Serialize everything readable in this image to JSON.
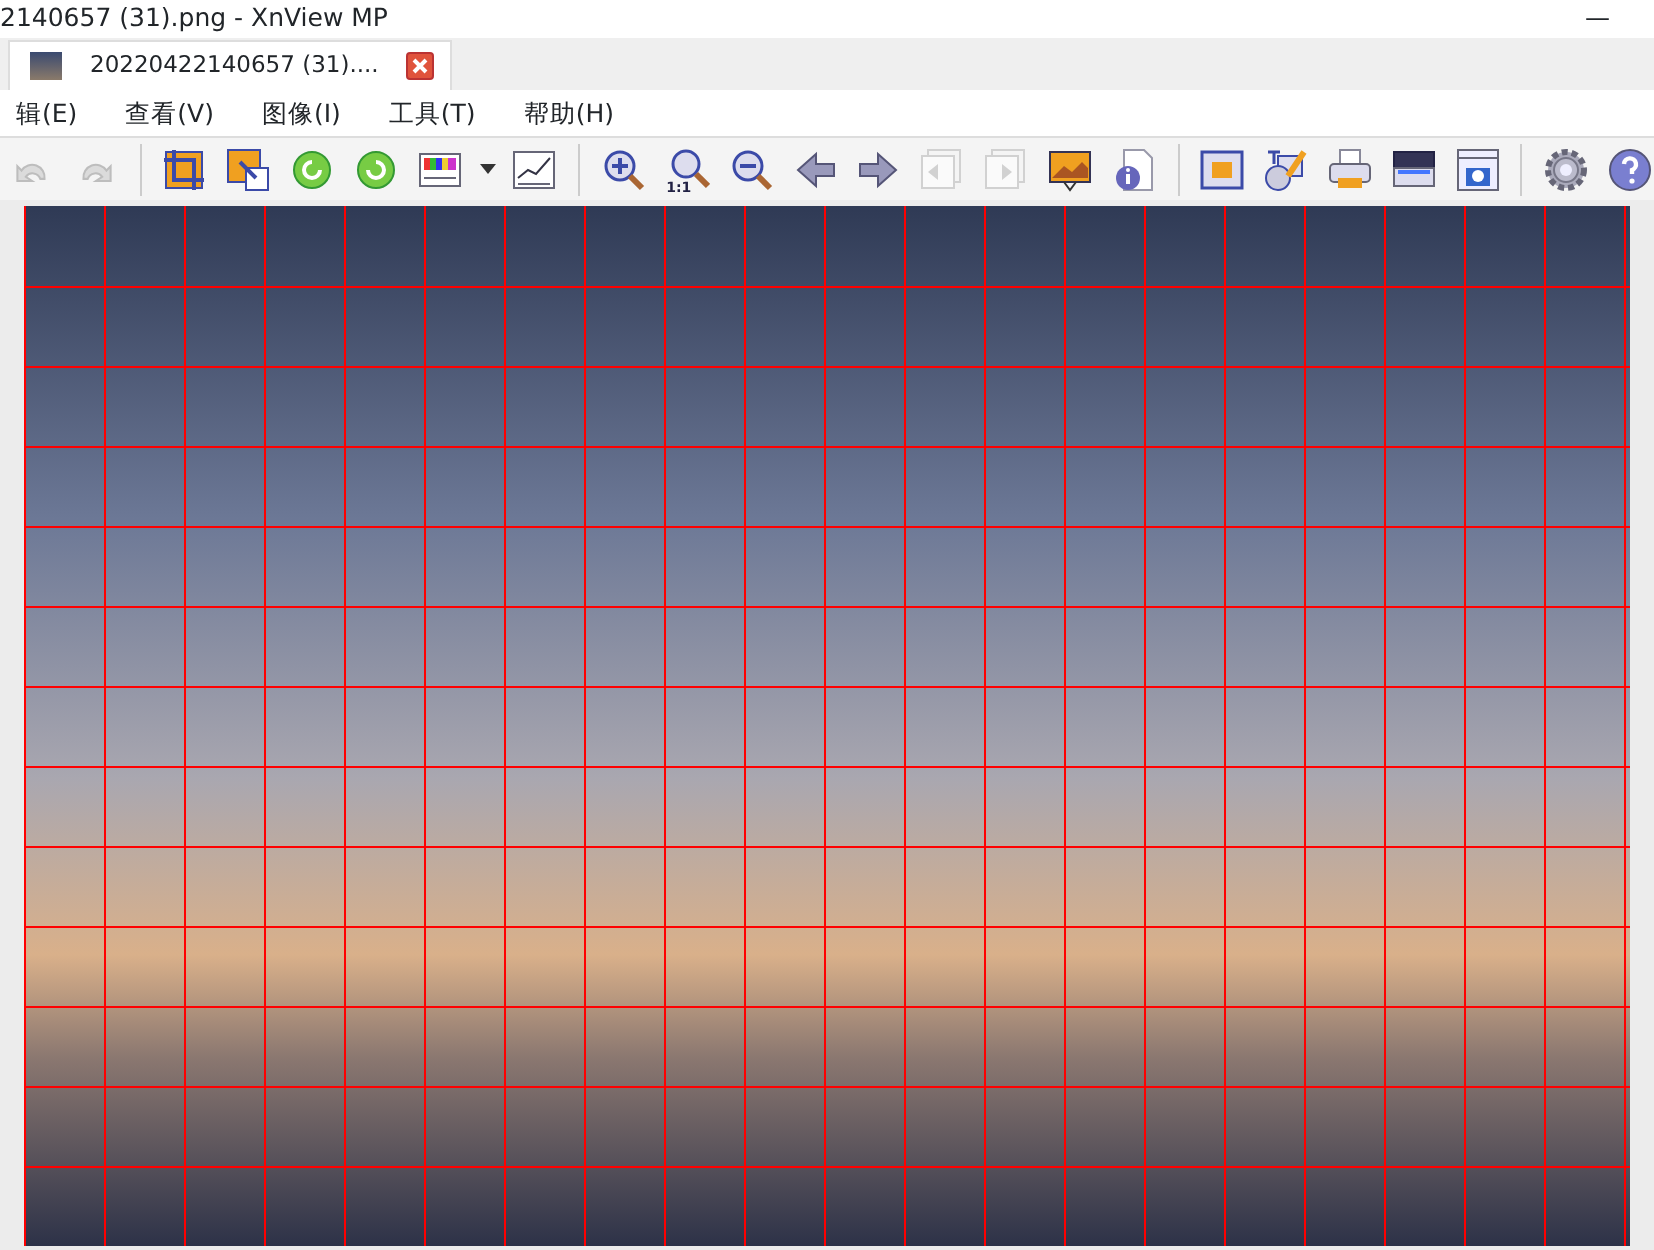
{
  "window": {
    "title": "2140657 (31).png - XnView MP",
    "minimize": "—"
  },
  "tabs": [
    {
      "label": "20220422140657 (31)....",
      "selected": true
    }
  ],
  "menu": [
    "辑(E)",
    "查看(V)",
    "图像(I)",
    "工具(T)",
    "帮助(H)"
  ],
  "toolbar": [
    {
      "kind": "undo",
      "disabled": true
    },
    {
      "kind": "redo",
      "disabled": true
    },
    {
      "kind": "separator"
    },
    {
      "kind": "crop",
      "disabled": false
    },
    {
      "kind": "resize",
      "disabled": false
    },
    {
      "kind": "rotate-left",
      "disabled": false
    },
    {
      "kind": "rotate-right",
      "disabled": false
    },
    {
      "kind": "colors",
      "disabled": false
    },
    {
      "kind": "dropdown",
      "disabled": false
    },
    {
      "kind": "levels",
      "disabled": false
    },
    {
      "kind": "separator"
    },
    {
      "kind": "zoom-in",
      "disabled": false
    },
    {
      "kind": "zoom-actual",
      "disabled": false,
      "label": "1:1"
    },
    {
      "kind": "zoom-out",
      "disabled": false
    },
    {
      "kind": "previous",
      "disabled": false
    },
    {
      "kind": "next",
      "disabled": false
    },
    {
      "kind": "previous-page",
      "disabled": true
    },
    {
      "kind": "next-page",
      "disabled": true
    },
    {
      "kind": "slideshow",
      "disabled": false
    },
    {
      "kind": "info",
      "disabled": false
    },
    {
      "kind": "separator"
    },
    {
      "kind": "fit",
      "disabled": false
    },
    {
      "kind": "edit-text",
      "disabled": false
    },
    {
      "kind": "print",
      "disabled": false
    },
    {
      "kind": "scan",
      "disabled": false
    },
    {
      "kind": "capture",
      "disabled": false
    },
    {
      "kind": "separator"
    },
    {
      "kind": "settings",
      "disabled": false
    },
    {
      "kind": "help",
      "disabled": false
    }
  ]
}
